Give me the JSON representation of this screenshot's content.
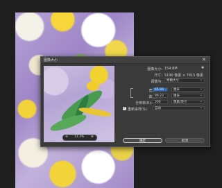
{
  "dialog": {
    "title": "图像大小",
    "close_glyph": "✕",
    "image_size_label": "图像大小:",
    "image_size_value": "154.8M",
    "dimensions_label": "尺寸:",
    "dimensions_value": "5190 像素 × 7815 像素",
    "fit_label": "调整为:",
    "fit_value": "原稿大小",
    "width_label": "宽度(D):",
    "width_value": "65.93",
    "width_unit": "厘米",
    "height_label": "高度(G):",
    "height_value": "99.23",
    "height_unit": "厘米",
    "resolution_label": "分辨率(R):",
    "resolution_value": "200",
    "resolution_unit": "像素/英寸",
    "resample_label": "重新采样(S):",
    "resample_value": "自动",
    "ok_label": "确定",
    "cancel_label": "取消",
    "zoom_value": "11.3%",
    "zoom_out": "⊖",
    "zoom_in": "⊕",
    "gear": "✱"
  }
}
